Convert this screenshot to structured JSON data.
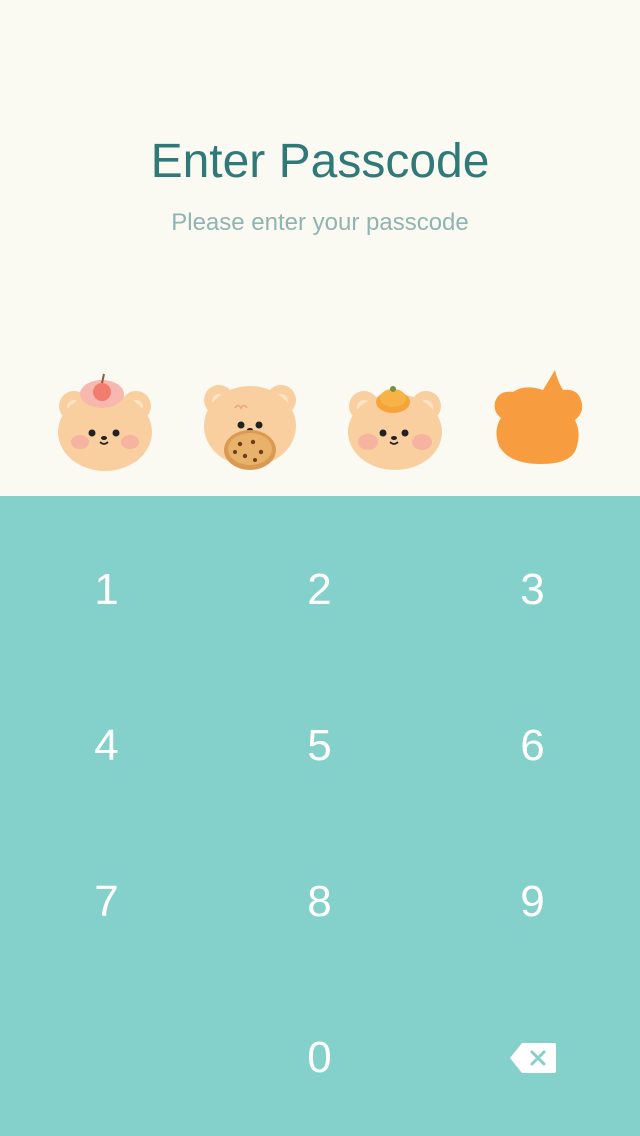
{
  "header": {
    "title": "Enter Passcode",
    "subtitle": "Please enter your passcode"
  },
  "indicators": [
    {
      "name": "bear-peach-icon",
      "filled": true
    },
    {
      "name": "bear-cookie-icon",
      "filled": true
    },
    {
      "name": "bear-orange-icon",
      "filled": true
    },
    {
      "name": "orange-blob-icon",
      "filled": false
    }
  ],
  "keypad": {
    "keys": [
      "1",
      "2",
      "3",
      "4",
      "5",
      "6",
      "7",
      "8",
      "9",
      "",
      "0"
    ],
    "delete_icon": "backspace-icon"
  },
  "colors": {
    "background_top": "#faf9f2",
    "keypad_bg": "#83d1ca",
    "title": "#2f7a78",
    "subtitle": "#8fb4b2",
    "bear": "#f9cf9f",
    "cheek": "#f4a9a0",
    "orange": "#f79c3f"
  }
}
